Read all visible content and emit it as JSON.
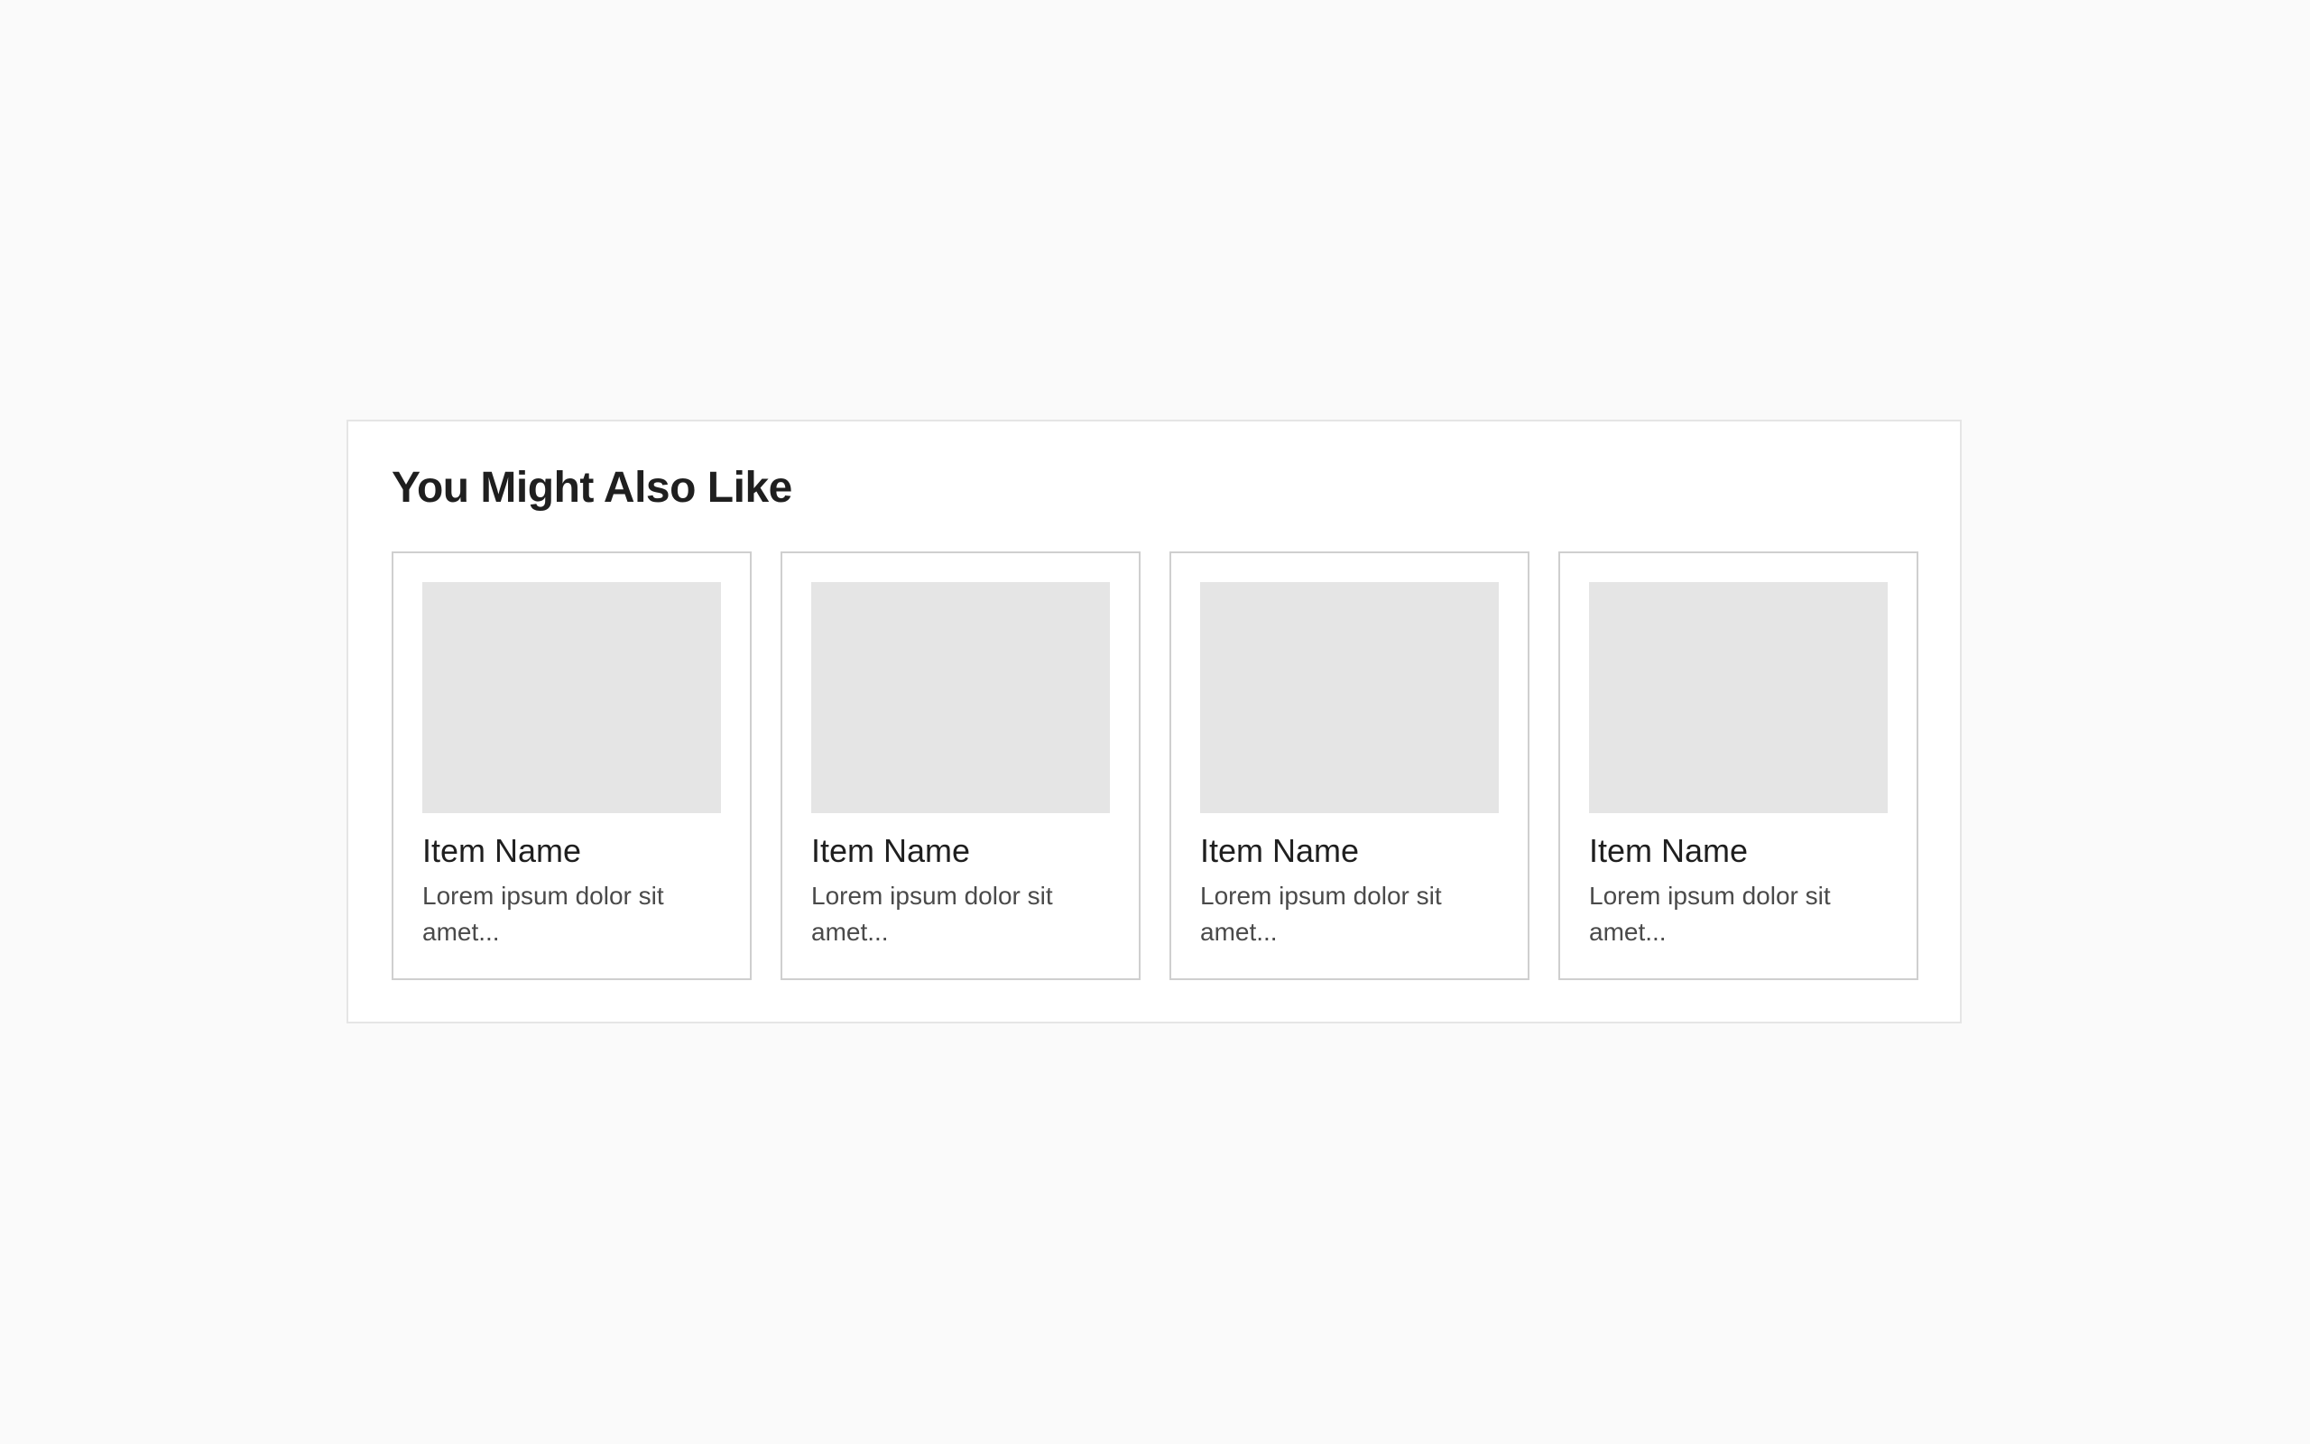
{
  "section": {
    "title": "You Might Also Like"
  },
  "items": [
    {
      "name": "Item Name",
      "description": "Lorem ipsum dolor sit amet..."
    },
    {
      "name": "Item Name",
      "description": "Lorem ipsum dolor sit amet..."
    },
    {
      "name": "Item Name",
      "description": "Lorem ipsum dolor sit amet..."
    },
    {
      "name": "Item Name",
      "description": "Lorem ipsum dolor sit amet..."
    }
  ],
  "colors": {
    "page_background": "#fafafa",
    "panel_background": "#ffffff",
    "image_placeholder": "#e5e5e5",
    "card_border": "#cfcfcf",
    "title_text": "#1f1f1f",
    "body_text": "#4a4a4a"
  }
}
